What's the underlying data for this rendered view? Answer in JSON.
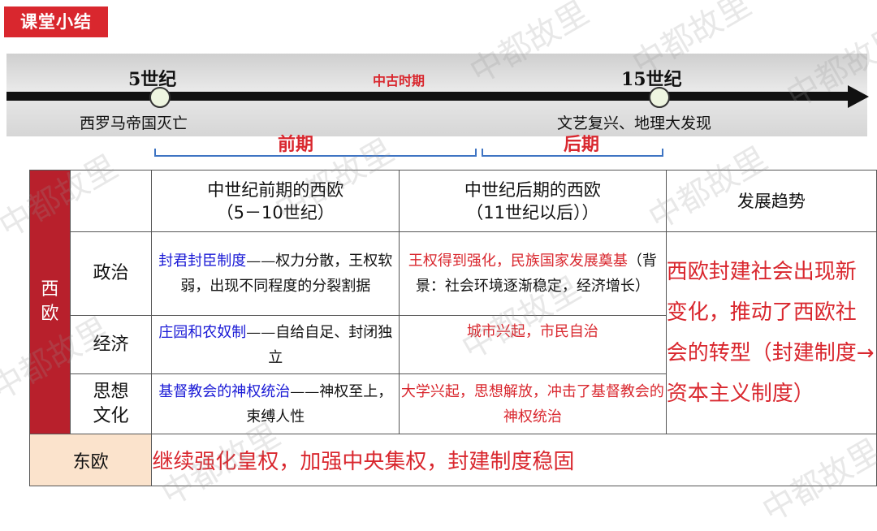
{
  "title": "课堂小结",
  "watermark": "中都故里",
  "timeline": {
    "left_century": "5世纪",
    "middle_label": "中古时期",
    "right_century": "15世纪",
    "left_event": "西罗马帝国灭亡",
    "right_event": "文艺复兴、地理大发现",
    "early_period": "前期",
    "late_period": "后期"
  },
  "table": {
    "region_west": "西欧",
    "header_early_1": "中世纪前期的西欧",
    "header_early_2": "（5－10世纪）",
    "header_late_1": "中世纪后期的西欧",
    "header_late_2": "（11世纪以后））",
    "header_trend": "发展趋势",
    "rows": [
      {
        "label": "政治",
        "early_highlight": "封君封臣制度",
        "early_rest": "——权力分散，王权软弱，出现不同程度的分裂割据",
        "late_highlight": "王权得到强化，民族国家发展奠基",
        "late_rest": "（背景：社会环境逐渐稳定，经济增长）"
      },
      {
        "label": "经济",
        "early_highlight": "庄园和农奴制",
        "early_rest": "——自给自足、封闭独立",
        "late_highlight": "城市兴起，市民自治",
        "late_rest": ""
      },
      {
        "label": "思想文化",
        "early_highlight": "基督教会的神权统治",
        "early_rest": "——神权至上，束缚人性",
        "late_highlight": "大学兴起，思想解放，冲击了基督教会的神权统治",
        "late_rest": ""
      }
    ],
    "trend_text": "西欧封建社会出现新变化，推动了西欧社会的转型（封建制度→资本主义制度）",
    "region_east": "东欧",
    "east_text": "继续强化皇权，加强中央集权，封建制度稳固"
  },
  "colors": {
    "accent_red": "#d9272e",
    "blue": "#1a1ad6",
    "dark_red": "#b8202c",
    "east_bg": "#fbe3cc"
  }
}
